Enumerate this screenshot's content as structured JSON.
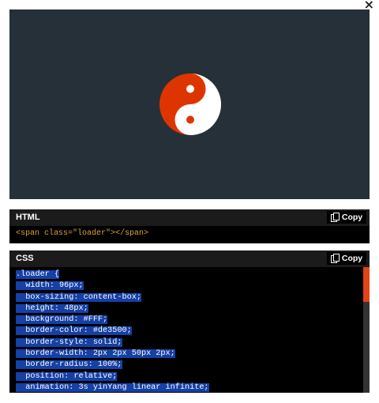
{
  "window": {
    "close_label": "×"
  },
  "preview": {
    "loader_color": "#de3500",
    "loader_secondary": "#FFF",
    "background": "#263038"
  },
  "html_panel": {
    "title": "HTML",
    "copy_label": "Copy",
    "code": "<span class=\"loader\"></span>"
  },
  "css_panel": {
    "title": "CSS",
    "copy_label": "Copy",
    "lines": [
      ".loader {",
      "  width: 96px;",
      "  box-sizing: content-box;",
      "  height: 48px;",
      "  background: #FFF;",
      "  border-color: #de3500;",
      "  border-style: solid;",
      "  border-width: 2px 2px 50px 2px;",
      "  border-radius: 100%;",
      "  position: relative;",
      "  animation: 3s yinYang linear infinite;"
    ],
    "selection_color": "#1540a6",
    "scroll_thumb_color": "#e04418"
  }
}
